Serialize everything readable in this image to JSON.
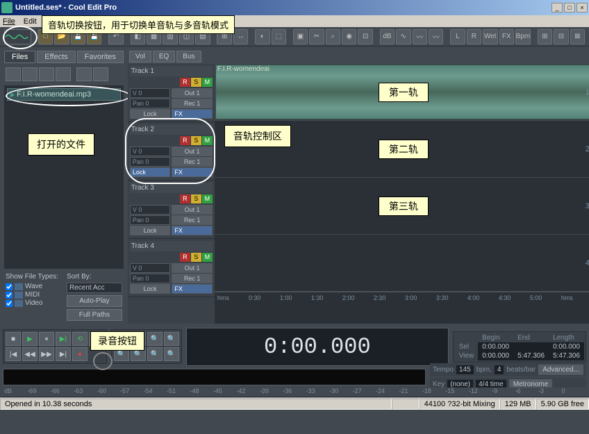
{
  "title": "Untitled.ses* - Cool Edit Pro",
  "menu": {
    "file": "File",
    "edit": "Edit"
  },
  "callouts": {
    "top": "音轨切换按钮，用于切换单音轨与多音轨模式",
    "opened_file": "打开的文件",
    "track_ctrl": "音轨控制区",
    "record": "录音按钮"
  },
  "left_tabs": {
    "files": "Files",
    "effects": "Effects",
    "favorites": "Favorites"
  },
  "file_item": "F.I.R-womendeai.mp3",
  "filter": {
    "show_label": "Show File Types:",
    "sort_label": "Sort By:",
    "wave": "Wave",
    "midi": "MIDI",
    "video": "Video",
    "recent": "Recent Acc",
    "autoplay": "Auto-Play",
    "fullpaths": "Full Paths"
  },
  "track_tabs": {
    "vol": "Vol",
    "eq": "EQ",
    "bus": "Bus"
  },
  "tracks": [
    {
      "name": "Track 1",
      "v": "V 0",
      "out": "Out 1",
      "pan": "Pan 0",
      "rec": "Rec 1",
      "lock": "Lock",
      "fx": "FX",
      "annot": "第一轨",
      "num": "1",
      "wavelabel": "F.I.R-womendeai"
    },
    {
      "name": "Track 2",
      "v": "V 0",
      "out": "Out 1",
      "pan": "Pan 0",
      "rec": "Rec 1",
      "lock": "Lock",
      "fx": "FX",
      "annot": "第二轨",
      "num": "2"
    },
    {
      "name": "Track 3",
      "v": "V 0",
      "out": "Out 1",
      "pan": "Pan 0",
      "rec": "Rec 1",
      "lock": "Lock",
      "fx": "FX",
      "annot": "第三轨",
      "num": "3"
    },
    {
      "name": "Track 4",
      "v": "V 0",
      "out": "Out 1",
      "pan": "Pan 0",
      "rec": "Rec 1",
      "lock": "Lock",
      "fx": "FX",
      "annot": "",
      "num": "4"
    }
  ],
  "rsm": {
    "r": "R",
    "s": "S",
    "m": "M"
  },
  "timeline": [
    "hms",
    "0:30",
    "1:00",
    "1:30",
    "2:00",
    "2:30",
    "3:00",
    "3:30",
    "4:00",
    "4:30",
    "5:00",
    "hms"
  ],
  "time_display": "0:00.000",
  "sel": {
    "begin": "Begin",
    "end": "End",
    "length": "Length",
    "sel_label": "Sel",
    "view_label": "View",
    "sel_begin": "0:00.000",
    "sel_end": "",
    "sel_len": "0:00.000",
    "view_begin": "0:00.000",
    "view_end": "5:47.306",
    "view_len": "5:47.306"
  },
  "tempo": {
    "tempo_label": "Tempo",
    "tempo_val": "145",
    "bpm": "bpm,",
    "beats_val": "4",
    "beats_label": "beats/bar",
    "key_label": "Key",
    "key_val": "(none)",
    "time_sig": "4/4 time",
    "advanced": "Advanced...",
    "metronome": "Metronome"
  },
  "db_marks": [
    "dB",
    "-69",
    "-66",
    "-63",
    "-60",
    "-57",
    "-54",
    "-51",
    "-48",
    "-45",
    "-42",
    "-39",
    "-36",
    "-33",
    "-30",
    "-27",
    "-24",
    "-21",
    "-18",
    "-15",
    "-12",
    "-9",
    "-6",
    "-3",
    "0"
  ],
  "status": {
    "opened": "Opened in 10.38 seconds",
    "mixing": "44100 ?32-bit Mixing",
    "mem": "129 MB",
    "free": "5.90 GB free"
  },
  "tb_labels": [
    "L",
    "R",
    "Wet",
    "FX",
    "Bpm"
  ]
}
